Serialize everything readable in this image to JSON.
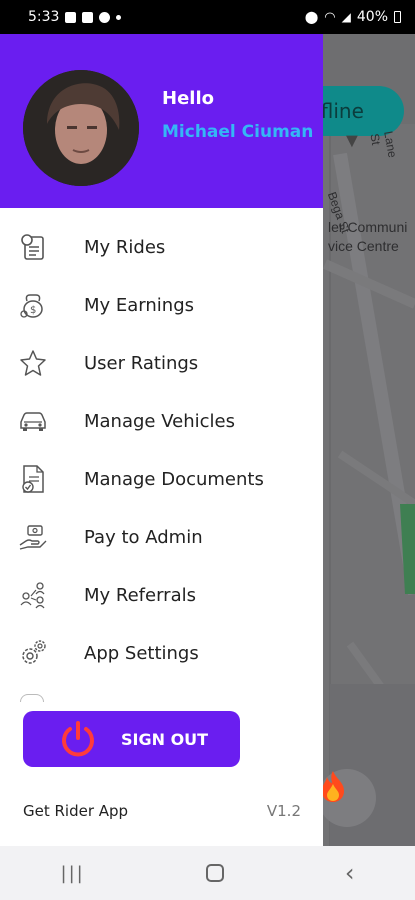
{
  "status_bar": {
    "time": "5:33",
    "battery": "40%"
  },
  "map": {
    "offline_label": "ffline",
    "labels": [
      "ler Communi",
      "vice Centre",
      "Bega St",
      "Lane St"
    ]
  },
  "drawer": {
    "greeting": "Hello",
    "user_name": "Michael Ciuman",
    "menu": [
      {
        "label": "My Rides",
        "icon": "rides-icon"
      },
      {
        "label": "My Earnings",
        "icon": "earnings-icon"
      },
      {
        "label": "User Ratings",
        "icon": "star-icon"
      },
      {
        "label": "Manage Vehicles",
        "icon": "car-icon"
      },
      {
        "label": "Manage Documents",
        "icon": "document-icon"
      },
      {
        "label": "Pay to Admin",
        "icon": "pay-icon"
      },
      {
        "label": "My Referrals",
        "icon": "referrals-icon"
      },
      {
        "label": "App Settings",
        "icon": "gear-icon"
      }
    ],
    "sign_out_label": "SIGN OUT",
    "footer": {
      "get_app": "Get Rider App",
      "version": "V1.2"
    }
  },
  "colors": {
    "primary": "#6a1ef0",
    "accent_name": "#35b7f5",
    "power_icon": "#ff3b3b"
  }
}
